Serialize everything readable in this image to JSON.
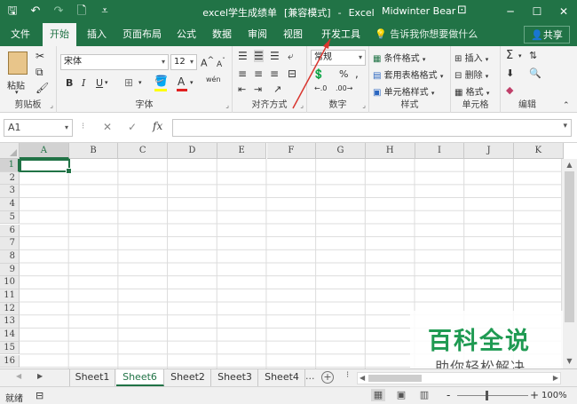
{
  "app": {
    "file_name": "excel学生成绩单",
    "mode": "[兼容模式]",
    "dash": "-",
    "app_name": "Excel",
    "user_name": "Midwinter Bear"
  },
  "quick_access": {
    "save_icon": "save-icon",
    "undo_icon": "undo-icon",
    "redo_icon": "redo-icon",
    "new_icon": "new-file-icon",
    "customize_icon": "customize-qat-icon"
  },
  "window_controls": {
    "ribbon_options_icon": "ribbon-display-options-icon",
    "minimize_icon": "minimize-icon",
    "restore_icon": "maximize-icon",
    "close_icon": "close-icon"
  },
  "tabs": [
    {
      "label": "文件"
    },
    {
      "label": "开始",
      "active": true
    },
    {
      "label": "插入"
    },
    {
      "label": "页面布局"
    },
    {
      "label": "公式"
    },
    {
      "label": "数据"
    },
    {
      "label": "审阅"
    },
    {
      "label": "视图"
    },
    {
      "label": "开发工具"
    }
  ],
  "tell_me": "告诉我你想要做什么",
  "share": "共享",
  "ribbon": {
    "clipboard": {
      "label": "剪贴板",
      "paste": "粘贴"
    },
    "font": {
      "label": "字体",
      "font_name": "宋体",
      "font_size": "12",
      "bold": "B",
      "italic": "I",
      "underline": "U",
      "grow": "A",
      "shrink": "A",
      "phonetic": "wén"
    },
    "alignment": {
      "label": "对齐方式"
    },
    "number": {
      "label": "数字",
      "format": "常规",
      "percent": "%",
      "comma": ","
    },
    "styles": {
      "label": "样式",
      "conditional": "条件格式",
      "table": "套用表格格式",
      "cell_styles": "单元格样式"
    },
    "cells": {
      "label": "单元格",
      "insert": "插入",
      "delete": "删除",
      "format": "格式"
    },
    "editing": {
      "label": "编辑",
      "sum": "Σ"
    }
  },
  "formula_bar": {
    "name_box": "A1",
    "cancel_icon": "cancel-icon",
    "enter_icon": "enter-icon",
    "fx": "fx",
    "value": ""
  },
  "grid": {
    "columns": [
      "A",
      "B",
      "C",
      "D",
      "E",
      "F",
      "G",
      "H",
      "I",
      "J",
      "K"
    ],
    "rows": [
      "1",
      "2",
      "3",
      "4",
      "5",
      "6",
      "7",
      "8",
      "9",
      "10",
      "11",
      "12",
      "13",
      "14",
      "15",
      "16"
    ],
    "active_cell": "A1"
  },
  "sheets": [
    {
      "label": "Sheet1"
    },
    {
      "label": "Sheet6",
      "active": true
    },
    {
      "label": "Sheet2"
    },
    {
      "label": "Sheet3"
    },
    {
      "label": "Sheet4"
    }
  ],
  "sheets_more": "...",
  "add_sheet": "+",
  "status": {
    "ready": "就绪",
    "zoom": "100%",
    "zoom_minus": "-",
    "zoom_plus": "+"
  },
  "watermark": {
    "title": "百科全说",
    "subtitle": "助你轻松解决"
  },
  "colors": {
    "brand": "#217346",
    "watermark": "#1f9a52",
    "annotation": "#d9362f"
  }
}
